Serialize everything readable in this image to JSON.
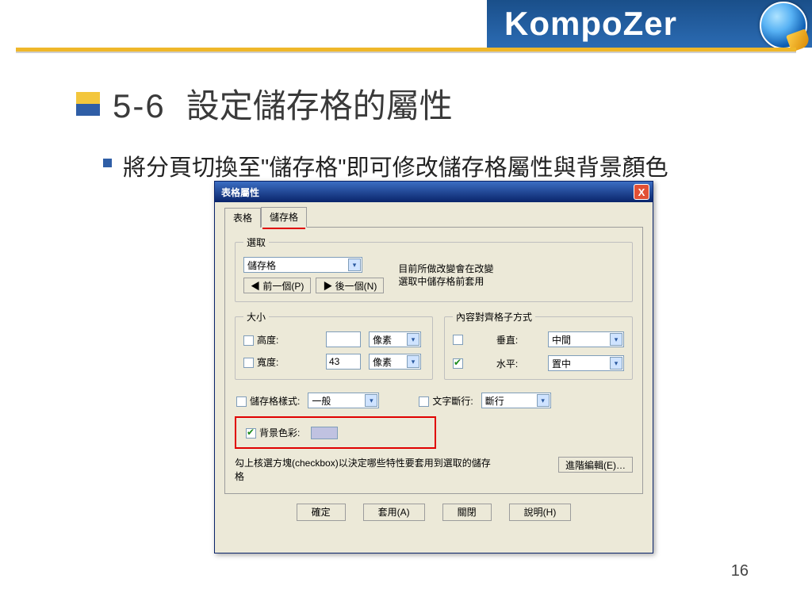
{
  "header": {
    "brand": "KompoZer"
  },
  "slide": {
    "section_number": "5-6",
    "title": "設定儲存格的屬性",
    "bullet": "將分頁切換至\"儲存格\"即可修改儲存格屬性與背景顏色",
    "page_number": "16"
  },
  "dialog": {
    "title": "表格屬性",
    "close": "X",
    "tabs": {
      "table": "表格",
      "cell": "儲存格",
      "active": "cell"
    },
    "selection": {
      "legend": "選取",
      "combo_value": "儲存格",
      "note_line1": "目前所做改變會在改變",
      "note_line2": "選取中儲存格前套用",
      "prev": "◀ 前一個(P)",
      "next": "▶ 後一個(N)"
    },
    "size": {
      "legend": "大小",
      "height_label": "高度:",
      "height_value": "",
      "height_unit": "像素",
      "width_label": "寬度:",
      "width_value": "43",
      "width_unit": "像素"
    },
    "align": {
      "legend": "內容對齊格子方式",
      "vertical_label": "垂直:",
      "vertical_value": "中間",
      "horizontal_label": "水平:",
      "horizontal_value": "置中",
      "horizontal_checked": true
    },
    "style": {
      "cell_style_label": "儲存格樣式:",
      "cell_style_value": "一般",
      "wrap_label": "文字斷行:",
      "wrap_value": "斷行"
    },
    "bg": {
      "label": "背景色彩:",
      "checked": true,
      "swatch": "#c0c2e1"
    },
    "hint": "勾上核選方塊(checkbox)以決定哪些特性要套用到選取的儲存格",
    "advanced": "進階編輯(E)…",
    "buttons": {
      "ok": "確定",
      "apply": "套用(A)",
      "close": "關閉",
      "help": "說明(H)"
    }
  }
}
